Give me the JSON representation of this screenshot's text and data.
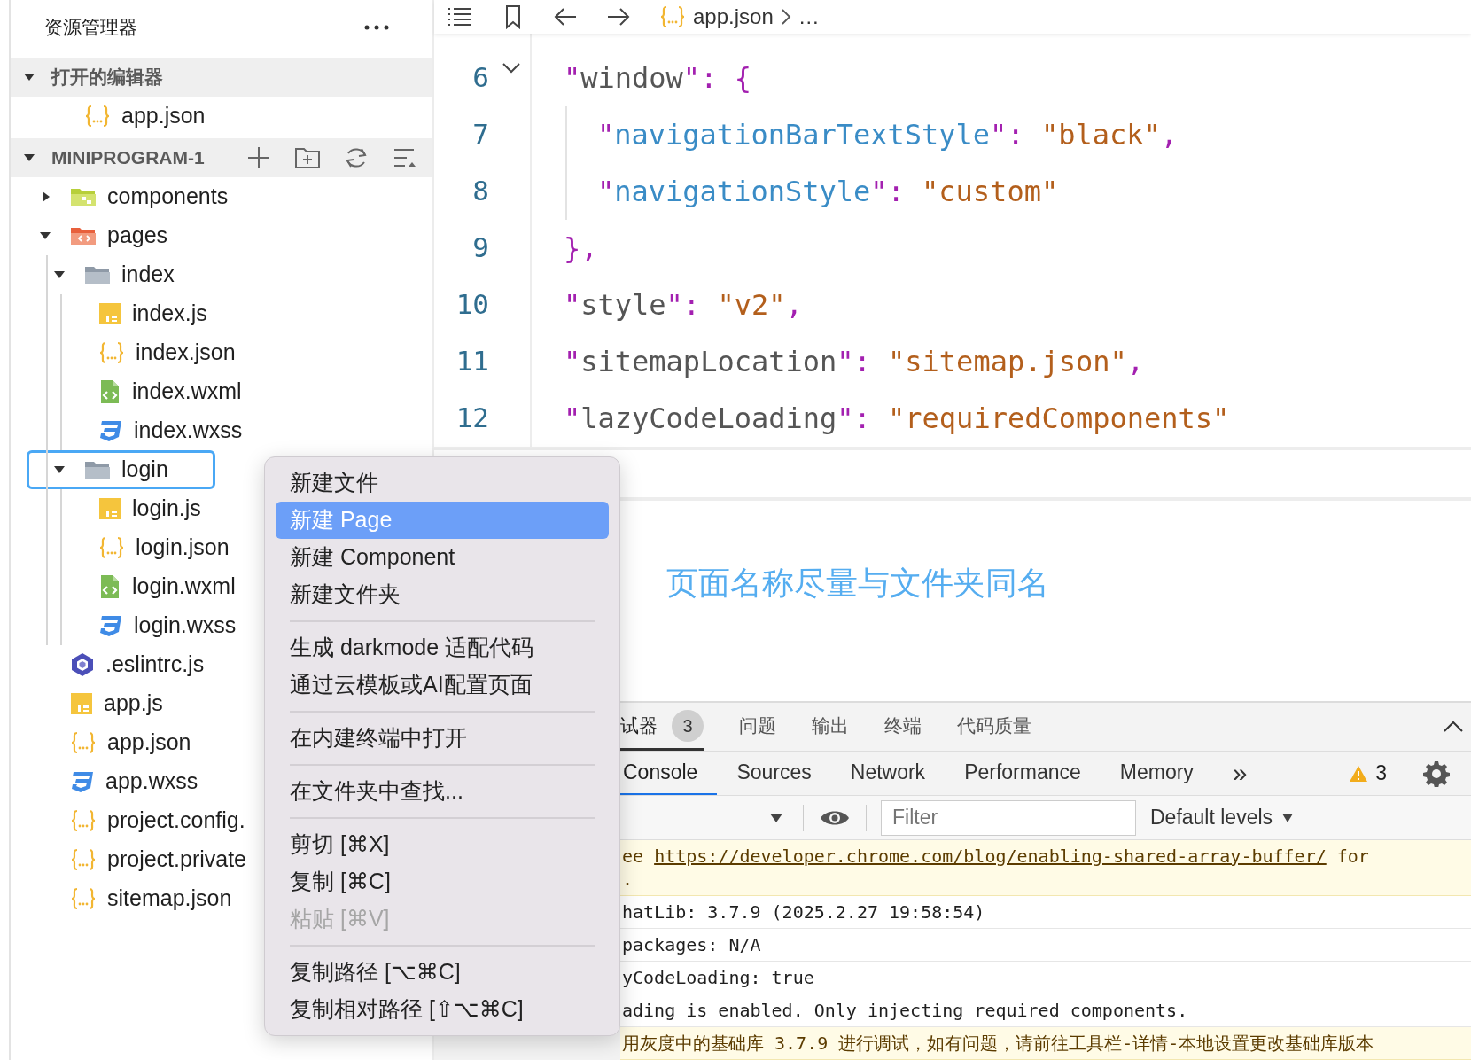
{
  "sidebar": {
    "title": "资源管理器",
    "sections": [
      {
        "title": "打开的编辑器",
        "expanded": true,
        "items": [
          {
            "label": "app.json",
            "kind": "json"
          }
        ]
      },
      {
        "title": "MINIPROGRAM-1",
        "expanded": true,
        "items": [
          {
            "label": "components",
            "kind": "folder-components",
            "expanded": false,
            "selected": false
          },
          {
            "label": "pages",
            "kind": "folder-pages",
            "expanded": true,
            "selected": false,
            "children": [
              {
                "label": "index",
                "kind": "folder",
                "expanded": true,
                "selected": false,
                "children": [
                  {
                    "label": "index.js",
                    "kind": "js",
                    "selected": false
                  },
                  {
                    "label": "index.json",
                    "kind": "json",
                    "selected": false
                  },
                  {
                    "label": "index.wxml",
                    "kind": "wxml",
                    "selected": false
                  },
                  {
                    "label": "index.wxss",
                    "kind": "wxss",
                    "selected": false
                  }
                ]
              },
              {
                "label": "login",
                "kind": "folder",
                "expanded": true,
                "selected": true,
                "children": [
                  {
                    "label": "login.js",
                    "kind": "js",
                    "selected": false
                  },
                  {
                    "label": "login.json",
                    "kind": "json",
                    "selected": false
                  },
                  {
                    "label": "login.wxml",
                    "kind": "wxml",
                    "selected": false
                  },
                  {
                    "label": "login.wxss",
                    "kind": "wxss",
                    "selected": false
                  }
                ]
              }
            ]
          },
          {
            "label": ".eslintrc.js",
            "kind": "eslint",
            "selected": false
          },
          {
            "label": "app.js",
            "kind": "js",
            "selected": false
          },
          {
            "label": "app.json",
            "kind": "json",
            "selected": false
          },
          {
            "label": "app.wxss",
            "kind": "wxss",
            "selected": false
          },
          {
            "label": "project.config.",
            "kind": "json",
            "selected": false
          },
          {
            "label": "project.private",
            "kind": "json",
            "selected": false
          },
          {
            "label": "sitemap.json",
            "kind": "json",
            "selected": false
          }
        ]
      }
    ]
  },
  "editor": {
    "breadcrumb": [
      {
        "label": "app.json",
        "kind": "json"
      },
      {
        "label": "…"
      }
    ],
    "lines": [
      {
        "number": "6",
        "tokens": [
          {
            "kind": "punct",
            "text": "\""
          },
          {
            "kind": "key",
            "text": "window"
          },
          {
            "kind": "punct",
            "text": "\": {"
          }
        ],
        "children": [
          {
            "number": "7",
            "tokens": [
              {
                "kind": "punct",
                "text": "\""
              },
              {
                "kind": "nested-key",
                "text": "navigationBarTextStyle"
              },
              {
                "kind": "punct",
                "text": "\": "
              },
              {
                "kind": "string",
                "text": "\"black\""
              },
              {
                "kind": "punct",
                "text": ","
              }
            ]
          },
          {
            "number": "8",
            "tokens": [
              {
                "kind": "punct",
                "text": "\""
              },
              {
                "kind": "nested-key",
                "text": "navigationStyle"
              },
              {
                "kind": "punct",
                "text": "\": "
              },
              {
                "kind": "string",
                "text": "\"custom\""
              }
            ]
          }
        ]
      },
      {
        "number": "9",
        "tokens": [
          {
            "kind": "punct",
            "text": "},"
          }
        ]
      },
      {
        "number": "10",
        "tokens": [
          {
            "kind": "punct",
            "text": "\""
          },
          {
            "kind": "key",
            "text": "style"
          },
          {
            "kind": "punct",
            "text": "\": "
          },
          {
            "kind": "string",
            "text": "\"v2\""
          },
          {
            "kind": "punct",
            "text": ","
          }
        ]
      },
      {
        "number": "11",
        "tokens": [
          {
            "kind": "punct",
            "text": "\""
          },
          {
            "kind": "key",
            "text": "sitemapLocation"
          },
          {
            "kind": "punct",
            "text": "\": "
          },
          {
            "kind": "string",
            "text": "\"sitemap.json\""
          },
          {
            "kind": "punct",
            "text": ","
          }
        ]
      },
      {
        "number": "12",
        "tokens": [
          {
            "kind": "punct",
            "text": "\""
          },
          {
            "kind": "key",
            "text": "lazyCodeLoading"
          },
          {
            "kind": "punct",
            "text": "\": "
          },
          {
            "kind": "string",
            "text": "\"requiredComponents\""
          }
        ]
      }
    ]
  },
  "hint": "页面名称尽量与文件夹同名",
  "context_menu": {
    "groups": [
      [
        {
          "label": "新建文件",
          "selected": false,
          "disabled": false
        },
        {
          "label": "新建 Page",
          "selected": true,
          "disabled": false
        },
        {
          "label": "新建 Component",
          "selected": false,
          "disabled": false
        },
        {
          "label": "新建文件夹",
          "selected": false,
          "disabled": false
        }
      ],
      [
        {
          "label": "生成 darkmode 适配代码",
          "selected": false,
          "disabled": false
        },
        {
          "label": "通过云模板或AI配置页面",
          "selected": false,
          "disabled": false
        }
      ],
      [
        {
          "label": "在内建终端中打开",
          "selected": false,
          "disabled": false
        }
      ],
      [
        {
          "label": "在文件夹中查找...",
          "selected": false,
          "disabled": false
        }
      ],
      [
        {
          "label": "剪切 [⌘X]",
          "selected": false,
          "disabled": false
        },
        {
          "label": "复制 [⌘C]",
          "selected": false,
          "disabled": false
        },
        {
          "label": "粘贴 [⌘V]",
          "selected": false,
          "disabled": true
        }
      ],
      [
        {
          "label": "复制路径 [⌥⌘C]",
          "selected": false,
          "disabled": false
        },
        {
          "label": "复制相对路径 [⇧⌥⌘C]",
          "selected": false,
          "disabled": false
        }
      ]
    ]
  },
  "devtools": {
    "panel_tabs": [
      {
        "label": "试器",
        "badge": "3",
        "selected": true
      },
      {
        "label": "问题",
        "selected": false
      },
      {
        "label": "输出",
        "selected": false
      },
      {
        "label": "终端",
        "selected": false
      },
      {
        "label": "代码质量",
        "selected": false
      }
    ],
    "tool_tabs": [
      {
        "label": "Console",
        "selected": true
      },
      {
        "label": "Sources",
        "selected": false
      },
      {
        "label": "Network",
        "selected": false
      },
      {
        "label": "Performance",
        "selected": false
      },
      {
        "label": "Memory",
        "selected": false
      }
    ],
    "more": "»",
    "warnings": "3",
    "filter": {
      "placeholder": "Filter"
    },
    "levels": "Default levels",
    "logs": [
      {
        "kind": "warning",
        "before": "ee ",
        "link": "https://developer.chrome.com/blog/enabling-shared-array-buffer/",
        "after": " for",
        "continuation": "."
      },
      {
        "kind": "info",
        "before": "hatLib: 3.7.9 (2025.2.27 19:58:54)"
      },
      {
        "kind": "info",
        "before": "packages: N/A"
      },
      {
        "kind": "info",
        "before": "yCodeLoading: true"
      },
      {
        "kind": "info",
        "before": "ading is enabled. Only injecting required components."
      },
      {
        "kind": "warning",
        "before": "用灰度中的基础库 3.7.9 进行调试，如有问题，请前往工具栏-详情-本地设置更改基础库版本"
      }
    ]
  }
}
